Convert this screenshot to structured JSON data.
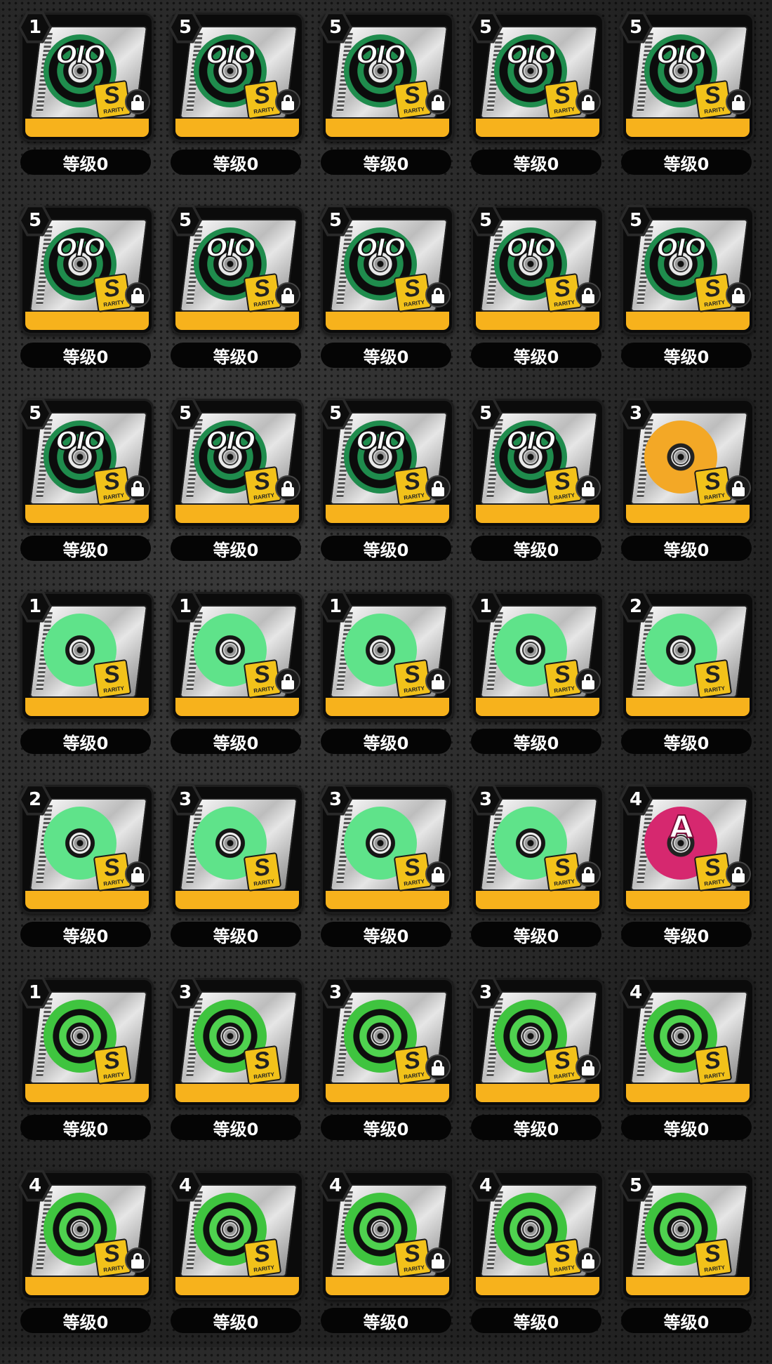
{
  "colors": {
    "card_stripe": "#f7b21c",
    "rarity_tag": "#f2c21a",
    "level_pill": "#050505",
    "badge": "#0d0d0d"
  },
  "rarity_label": "RARITY",
  "items": [
    {
      "badge": "1",
      "level": "等级0",
      "theme": "t-oio",
      "cover": "OIO",
      "rarity": "S",
      "locked": true
    },
    {
      "badge": "5",
      "level": "等级0",
      "theme": "t-oio",
      "cover": "OIO",
      "rarity": "S",
      "locked": true
    },
    {
      "badge": "5",
      "level": "等级0",
      "theme": "t-oio",
      "cover": "OIO",
      "rarity": "S",
      "locked": true
    },
    {
      "badge": "5",
      "level": "等级0",
      "theme": "t-oio",
      "cover": "OIO",
      "rarity": "S",
      "locked": true
    },
    {
      "badge": "5",
      "level": "等级0",
      "theme": "t-oio",
      "cover": "OIO",
      "rarity": "S",
      "locked": true
    },
    {
      "badge": "5",
      "level": "等级0",
      "theme": "t-oio",
      "cover": "OIO",
      "rarity": "S",
      "locked": true
    },
    {
      "badge": "5",
      "level": "等级0",
      "theme": "t-oio",
      "cover": "OIO",
      "rarity": "S",
      "locked": true
    },
    {
      "badge": "5",
      "level": "等级0",
      "theme": "t-oio",
      "cover": "OIO",
      "rarity": "S",
      "locked": true
    },
    {
      "badge": "5",
      "level": "等级0",
      "theme": "t-oio",
      "cover": "OIO",
      "rarity": "S",
      "locked": true
    },
    {
      "badge": "5",
      "level": "等级0",
      "theme": "t-oio",
      "cover": "OIO",
      "rarity": "S",
      "locked": true
    },
    {
      "badge": "5",
      "level": "等级0",
      "theme": "t-oio",
      "cover": "OIO",
      "rarity": "S",
      "locked": true
    },
    {
      "badge": "5",
      "level": "等级0",
      "theme": "t-oio",
      "cover": "OIO",
      "rarity": "S",
      "locked": true
    },
    {
      "badge": "5",
      "level": "等级0",
      "theme": "t-oio",
      "cover": "OIO",
      "rarity": "S",
      "locked": true
    },
    {
      "badge": "5",
      "level": "等级0",
      "theme": "t-oio",
      "cover": "OIO",
      "rarity": "S",
      "locked": true
    },
    {
      "badge": "3",
      "level": "等级0",
      "theme": "t-gold",
      "cover": "",
      "rarity": "S",
      "locked": true
    },
    {
      "badge": "1",
      "level": "等级0",
      "theme": "t-ninja",
      "cover": "",
      "rarity": "S",
      "locked": false
    },
    {
      "badge": "1",
      "level": "等级0",
      "theme": "t-ninja",
      "cover": "",
      "rarity": "S",
      "locked": true
    },
    {
      "badge": "1",
      "level": "等级0",
      "theme": "t-ninja",
      "cover": "",
      "rarity": "S",
      "locked": true
    },
    {
      "badge": "1",
      "level": "等级0",
      "theme": "t-ninja",
      "cover": "",
      "rarity": "S",
      "locked": true
    },
    {
      "badge": "2",
      "level": "等级0",
      "theme": "t-ninja",
      "cover": "",
      "rarity": "S",
      "locked": false
    },
    {
      "badge": "2",
      "level": "等级0",
      "theme": "t-ninja",
      "cover": "",
      "rarity": "S",
      "locked": true
    },
    {
      "badge": "3",
      "level": "等级0",
      "theme": "t-ninja",
      "cover": "",
      "rarity": "S",
      "locked": false
    },
    {
      "badge": "3",
      "level": "等级0",
      "theme": "t-ninja",
      "cover": "",
      "rarity": "S",
      "locked": true
    },
    {
      "badge": "3",
      "level": "等级0",
      "theme": "t-ninja",
      "cover": "",
      "rarity": "S",
      "locked": true
    },
    {
      "badge": "4",
      "level": "等级0",
      "theme": "t-pink",
      "cover": "A",
      "rarity": "S",
      "locked": true
    },
    {
      "badge": "1",
      "level": "等级0",
      "theme": "t-teq",
      "cover": "",
      "rarity": "S",
      "locked": false
    },
    {
      "badge": "3",
      "level": "等级0",
      "theme": "t-teq",
      "cover": "",
      "rarity": "S",
      "locked": false
    },
    {
      "badge": "3",
      "level": "等级0",
      "theme": "t-teq",
      "cover": "",
      "rarity": "S",
      "locked": true
    },
    {
      "badge": "3",
      "level": "等级0",
      "theme": "t-teq",
      "cover": "",
      "rarity": "S",
      "locked": true
    },
    {
      "badge": "4",
      "level": "等级0",
      "theme": "t-teq",
      "cover": "",
      "rarity": "S",
      "locked": false
    },
    {
      "badge": "4",
      "level": "等级0",
      "theme": "t-teq",
      "cover": "",
      "rarity": "S",
      "locked": true
    },
    {
      "badge": "4",
      "level": "等级0",
      "theme": "t-teq",
      "cover": "",
      "rarity": "S",
      "locked": false
    },
    {
      "badge": "4",
      "level": "等级0",
      "theme": "t-teq",
      "cover": "",
      "rarity": "S",
      "locked": true
    },
    {
      "badge": "4",
      "level": "等级0",
      "theme": "t-teq",
      "cover": "",
      "rarity": "S",
      "locked": true
    },
    {
      "badge": "5",
      "level": "等级0",
      "theme": "t-teq",
      "cover": "",
      "rarity": "S",
      "locked": false
    }
  ]
}
